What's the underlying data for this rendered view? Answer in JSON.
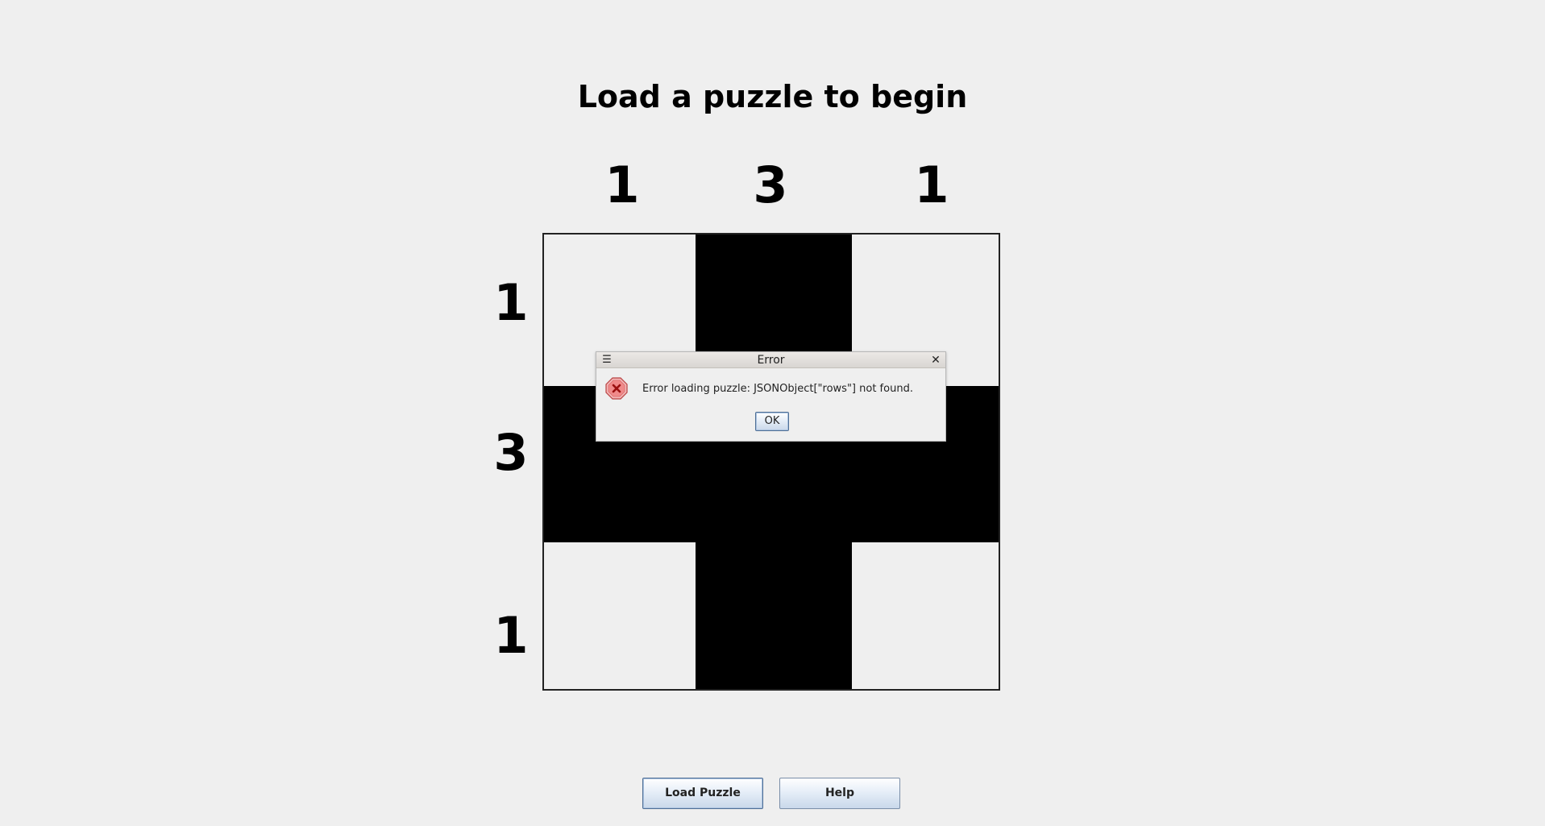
{
  "window": {
    "status_title": "Load a puzzle to begin"
  },
  "puzzle": {
    "column_clues": [
      "1",
      "3",
      "1"
    ],
    "row_clues": [
      "1",
      "3",
      "1"
    ],
    "cells": [
      [
        false,
        true,
        false
      ],
      [
        true,
        true,
        true
      ],
      [
        false,
        true,
        false
      ]
    ],
    "fill_color": "#000000",
    "empty_color": "#efefef"
  },
  "buttons": {
    "load_label": "Load Puzzle",
    "help_label": "Help"
  },
  "dialog": {
    "title": "Error",
    "message": "Error loading puzzle: JSONObject[\"rows\"] not found.",
    "ok_label": "OK",
    "icon": "error-icon",
    "menu_icon": "menu-icon",
    "close_icon": "close-icon"
  }
}
